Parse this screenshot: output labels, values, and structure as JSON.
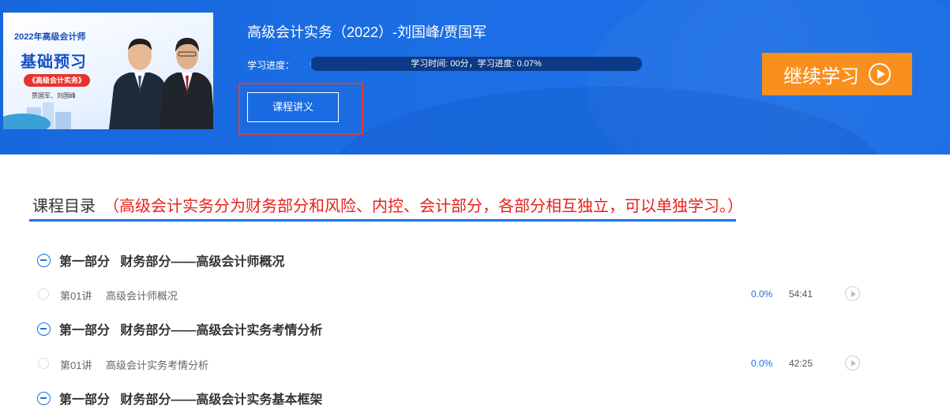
{
  "cover": {
    "year_line": "2022年高级会计师",
    "main_line": "基础预习",
    "tag": "《高级会计实务》",
    "authors": "贾国军、刘国峰"
  },
  "course": {
    "title": "高级会计实务（2022）-刘国峰/贾国军",
    "progress_label": "学习进度：",
    "progress_text": "学习时间: 00分，学习进度: 0.07%",
    "progress_fraction": 0.0007,
    "handout_label": "课程讲义",
    "continue_label": "继续学习"
  },
  "catalog": {
    "title": "课程目录",
    "note": "（高级会计实务分为财务部分和风险、内控、会计部分，各部分相互独立，可以单独学习。）",
    "sections": [
      {
        "title": "第一部分   财务部分——高级会计师概况",
        "lessons": [
          {
            "number": "第01讲",
            "name": "高级会计师概况",
            "percent": "0.0%",
            "duration": "54:41"
          }
        ]
      },
      {
        "title": "第一部分   财务部分——高级会计实务考情分析",
        "lessons": [
          {
            "number": "第01讲",
            "name": "高级会计实务考情分析",
            "percent": "0.0%",
            "duration": "42:25"
          }
        ]
      },
      {
        "title": "第一部分   财务部分——高级会计实务基本框架",
        "lessons": []
      }
    ]
  },
  "colors": {
    "header_blue": "#1c6fe6",
    "accent_orange": "#f98f1d",
    "highlight_red": "#e53b2f",
    "note_red": "#e8201a",
    "link_blue": "#1e6fe0"
  }
}
